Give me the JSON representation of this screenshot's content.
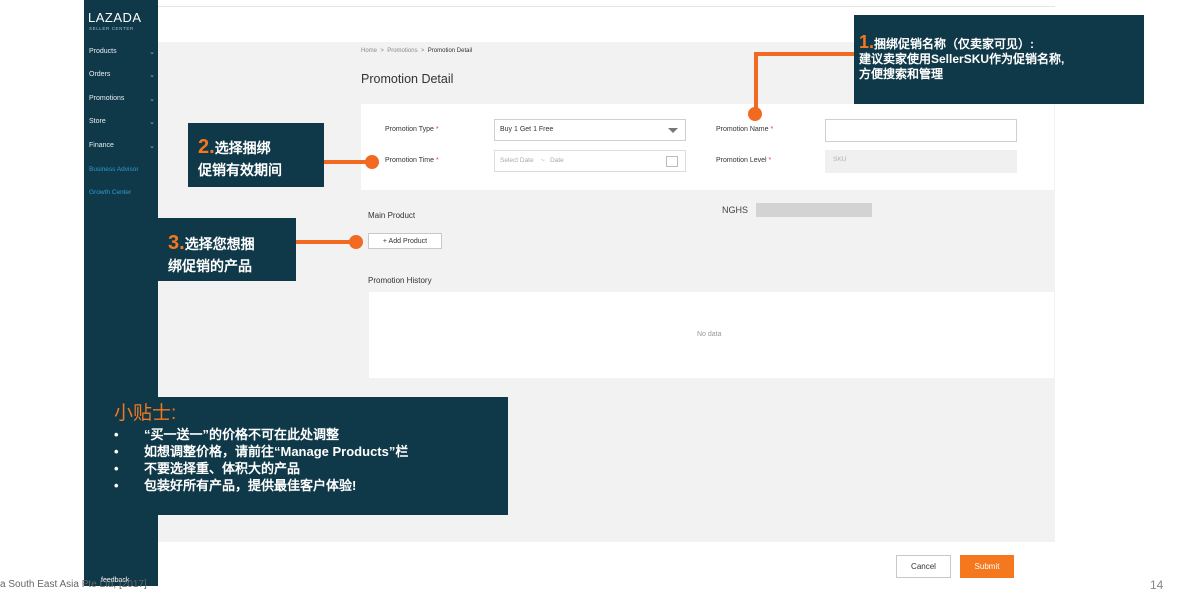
{
  "sidebar": {
    "logo": "LAZADA",
    "logo_sub": "SELLER CENTER",
    "items": [
      {
        "label": "Products"
      },
      {
        "label": "Orders"
      },
      {
        "label": "Promotions"
      },
      {
        "label": "Store"
      },
      {
        "label": "Finance"
      }
    ],
    "links": [
      {
        "label": "Business Advisor"
      },
      {
        "label": "Growth Center"
      }
    ],
    "feedback": "feedback",
    "chevron": "⌄"
  },
  "breadcrumb": {
    "home": "Home",
    "sep": ">",
    "promotions": "Promotions",
    "current": "Promotion Detail"
  },
  "page_title": "Promotion Detail",
  "form": {
    "type_label": "Promotion Type",
    "type_value": "Buy 1 Get 1 Free",
    "time_label": "Promotion Time",
    "date_start_placeholder": "Select Date",
    "date_sep": "~",
    "date_end_placeholder": "Date",
    "name_label": "Promotion Name",
    "name_value": "",
    "level_label": "Promotion Level",
    "level_value": "SKU",
    "required_mark": "*"
  },
  "main_product": {
    "label": "Main Product",
    "add_button": "+ Add Product",
    "sku": "NGHS"
  },
  "history": {
    "label": "Promotion History",
    "empty": "No data"
  },
  "actions": {
    "cancel": "Cancel",
    "submit": "Submit"
  },
  "callouts": {
    "c1_num": "1.",
    "c1_line1": "捆绑促销名称（仅卖家可见）:",
    "c1_line2": "建议卖家使用SellerSKU作为促销名称,",
    "c1_line3": "方便搜索和管理",
    "c2_num": "2.",
    "c2_line1": "选择捆绑",
    "c2_line2": "促销有效期间",
    "c3_num": "3.",
    "c3_line1": "选择您想捆",
    "c3_line2": "绑促销的产品"
  },
  "tips": {
    "title": "小贴士:",
    "bullet": "•",
    "items": [
      "“买一送一”的价格不可在此处调整",
      "如想调整价格，请前往“Manage Products”栏",
      "不要选择重、体积大的产品",
      "包装好所有产品，提供最佳客户体验!"
    ]
  },
  "footer": "a South East Asia Pte Ltd, [2017]",
  "page_number": "14",
  "colors": {
    "sidebar": "#0f3848",
    "accent": "#f5781e",
    "required": "#e4393c"
  }
}
